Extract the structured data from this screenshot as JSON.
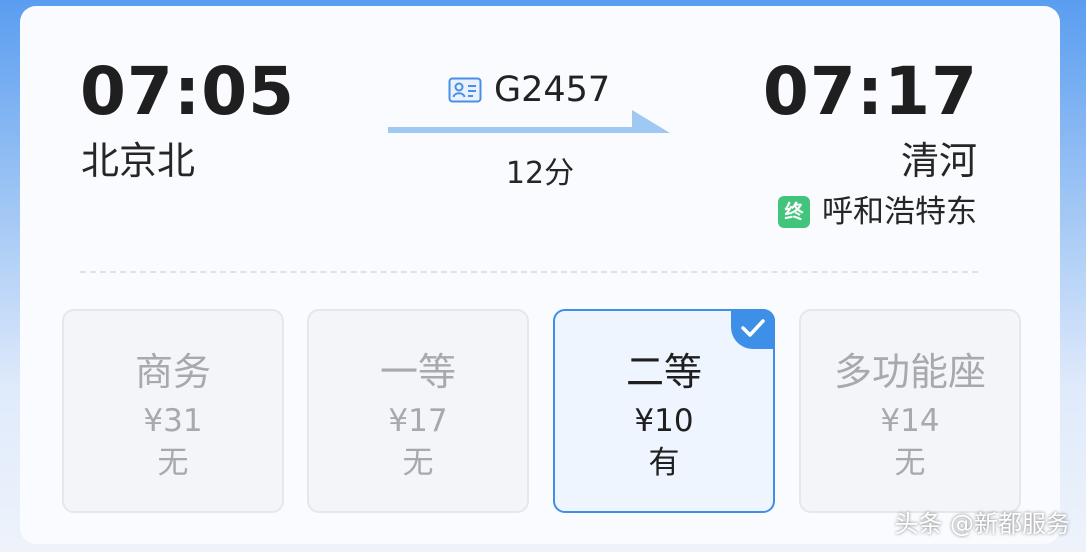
{
  "departure": {
    "time": "07:05",
    "station": "北京北"
  },
  "arrival": {
    "time": "07:17",
    "station": "清河"
  },
  "terminal": {
    "badge": "终",
    "station": "呼和浩特东"
  },
  "train": {
    "number": "G2457",
    "duration": "12分",
    "icon": "train-ticket-icon"
  },
  "seats": [
    {
      "name": "商务",
      "price": "¥31",
      "availability": "无",
      "selected": false
    },
    {
      "name": "一等",
      "price": "¥17",
      "availability": "无",
      "selected": false
    },
    {
      "name": "二等",
      "price": "¥10",
      "availability": "有",
      "selected": true
    },
    {
      "name": "多功能座",
      "price": "¥14",
      "availability": "无",
      "selected": false
    }
  ],
  "watermark": "头条 @新都服务",
  "colors": {
    "accent": "#3d8fe8",
    "terminal_badge": "#43c47c",
    "unavailable_text": "#a6a9ae"
  }
}
